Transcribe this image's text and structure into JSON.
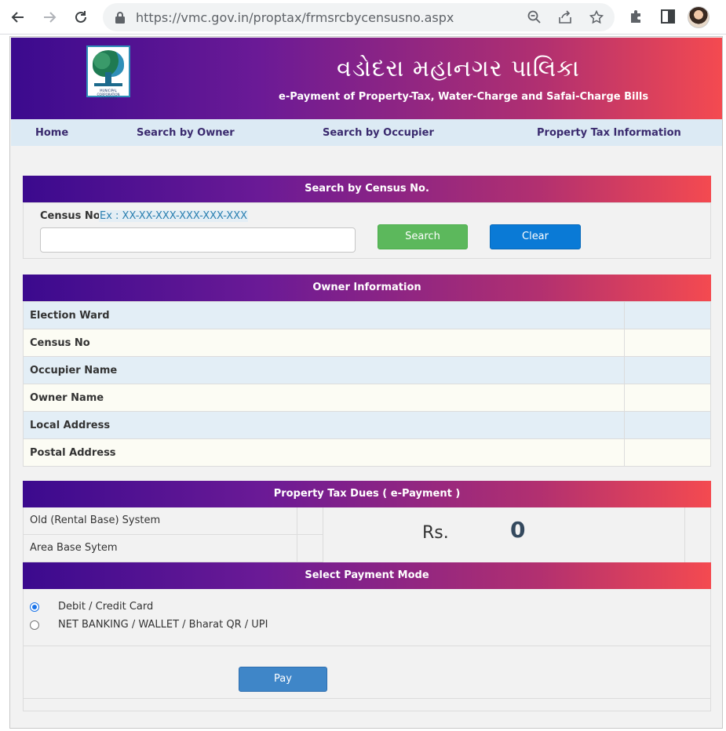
{
  "browser": {
    "url_host": "https://vmc.gov.in",
    "url_path": "/proptax/frmsrcbycensusno.aspx"
  },
  "banner": {
    "title_gujarati": "વડોદરા મહાનગર પાલિકા",
    "subtitle": "e-Payment of Property-Tax, Water-Charge and Safai-Charge Bills",
    "logo_caption": "MUNICIPAL CORPORATION VADODARA"
  },
  "menu": {
    "items": [
      "Home",
      "Search by Owner",
      "Search by Occupier",
      "Property Tax Information"
    ]
  },
  "search": {
    "heading": "Search by Census No.",
    "label": "Census No.",
    "example": "Ex : XX-XX-XXX-XXX-XXX-XXX",
    "input_value": "",
    "search_button": "Search",
    "clear_button": "Clear"
  },
  "owner_info": {
    "heading": "Owner Information",
    "rows": [
      {
        "label": "Election Ward",
        "value": ""
      },
      {
        "label": "Census No",
        "value": ""
      },
      {
        "label": "Occupier Name",
        "value": ""
      },
      {
        "label": "Owner Name",
        "value": ""
      },
      {
        "label": "Local Address",
        "value": ""
      },
      {
        "label": "Postal Address",
        "value": ""
      }
    ]
  },
  "dues": {
    "heading": "Property Tax Dues ( e-Payment )",
    "rows": [
      "Old (Rental Base) System",
      "Area Base Sytem"
    ],
    "currency": "Rs.",
    "amount": "0"
  },
  "payment": {
    "heading": "Select Payment Mode",
    "options": [
      {
        "label": "Debit / Credit Card",
        "selected": true
      },
      {
        "label": "NET BANKING / WALLET / Bharat QR / UPI",
        "selected": false
      }
    ],
    "pay_button": "Pay"
  }
}
